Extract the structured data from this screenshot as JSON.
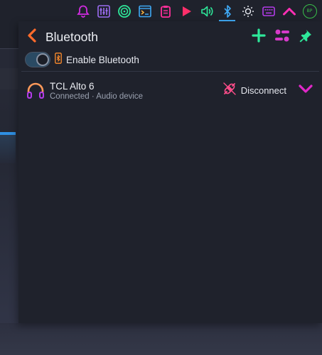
{
  "colors": {
    "accent_orange": "#ff6b2b",
    "accent_green": "#2ee89a",
    "accent_magenta": "#e028c8",
    "accent_blue": "#3fa9f5"
  },
  "topbar": {
    "icons": [
      {
        "name": "bell-icon",
        "color": "#d12be0"
      },
      {
        "name": "mixer-icon",
        "color": "#9b6cf0"
      },
      {
        "name": "disc-icon",
        "color": "#2ee89a"
      },
      {
        "name": "terminal-icon",
        "color": "#3fa9f5"
      },
      {
        "name": "clipboard-icon",
        "color": "#ff2f9a"
      },
      {
        "name": "play-icon",
        "color": "#ff2f6a"
      },
      {
        "name": "volume-icon",
        "color": "#2ee89a"
      },
      {
        "name": "bluetooth-icon",
        "color": "#3fa9f5"
      },
      {
        "name": "brightness-icon",
        "color": "#e6e8ef"
      },
      {
        "name": "keyboard-icon",
        "color": "#b23be8"
      },
      {
        "name": "chevron-up-icon",
        "color": "#ff2fb4"
      }
    ],
    "avatar_text": "BP"
  },
  "panel": {
    "title": "Bluetooth",
    "toggle_label": "Enable Bluetooth",
    "toggle_on": true,
    "devices": [
      {
        "name": "TCL Alto 6",
        "status": "Connected · Audio device",
        "action_label": "Disconnect"
      }
    ]
  }
}
